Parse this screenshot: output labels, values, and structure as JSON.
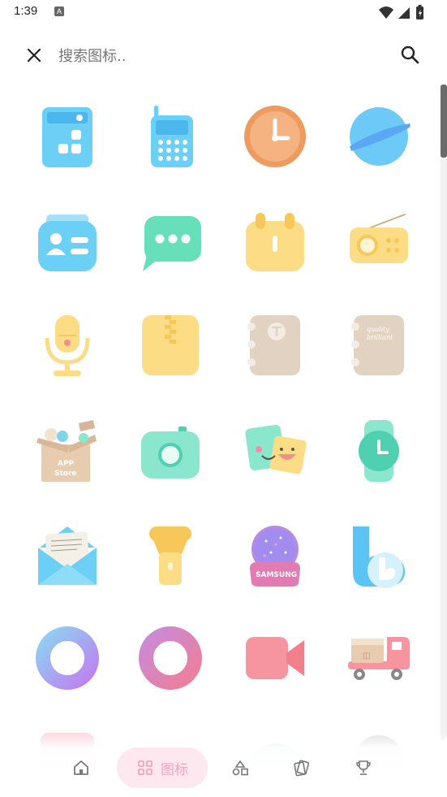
{
  "status_bar": {
    "time": "1:39",
    "sim_badge": "A"
  },
  "search": {
    "placeholder": "搜索图标..",
    "value": ""
  },
  "icons": [
    {
      "name": "calculator-icon",
      "color": "#6cd0f6"
    },
    {
      "name": "phone-icon",
      "color": "#6cd0f6"
    },
    {
      "name": "clock-icon",
      "color": "#f0a872"
    },
    {
      "name": "browser-planet-icon",
      "color": "#6cc9f8"
    },
    {
      "name": "contacts-icon",
      "color": "#6cd0f6"
    },
    {
      "name": "messages-icon",
      "color": "#67dfb9"
    },
    {
      "name": "calendar-icon",
      "color": "#fddc86"
    },
    {
      "name": "radio-icon",
      "color": "#fddc86"
    },
    {
      "name": "microphone-icon",
      "color": "#fddc86"
    },
    {
      "name": "archive-zip-icon",
      "color": "#fddc86"
    },
    {
      "name": "notebook-t-icon",
      "color": "#e2d2c2"
    },
    {
      "name": "notebook-quality-icon",
      "color": "#e2d2c2"
    },
    {
      "name": "app-store-box-icon",
      "color": "#e8ccb0"
    },
    {
      "name": "camera-icon",
      "color": "#8ae6cc"
    },
    {
      "name": "stickers-icon",
      "color": "#8ae6cc"
    },
    {
      "name": "watch-icon",
      "color": "#67dfb9"
    },
    {
      "name": "email-envelope-icon",
      "color": "#6cd0f6"
    },
    {
      "name": "flashlight-icon",
      "color": "#fddc86"
    },
    {
      "name": "samsung-globe-icon",
      "color": "#b48ae6"
    },
    {
      "name": "bixby-icon",
      "color": "#6cd0f6"
    },
    {
      "name": "ring-purple-icon",
      "color": "#9fa4f5"
    },
    {
      "name": "ring-pink-icon",
      "color": "#d77bb0"
    },
    {
      "name": "video-camera-icon",
      "color": "#f6949f"
    },
    {
      "name": "delivery-truck-icon",
      "color": "#f6949f"
    }
  ],
  "ui_text": {
    "notebook_quality": "quality\nbrilliant",
    "app_store_line1": "APP",
    "app_store_line2": "Store",
    "samsung_label": "SAMSUNG",
    "letter_paper": "Forever the Break"
  },
  "bottom_nav": {
    "items": [
      {
        "name": "home",
        "label": ""
      },
      {
        "name": "icons",
        "label": "图标",
        "active": true
      },
      {
        "name": "shapes",
        "label": ""
      },
      {
        "name": "wallpapers",
        "label": ""
      },
      {
        "name": "trophy",
        "label": ""
      }
    ]
  },
  "colors": {
    "accent_pink": "#f3a3bd",
    "accent_pill_bg": "#fde8ef",
    "blue": "#6cd0f6",
    "green": "#67dfb9",
    "yellow": "#fddc86",
    "orange": "#f0a872",
    "beige": "#e2d2c2",
    "pink": "#f6949f"
  }
}
